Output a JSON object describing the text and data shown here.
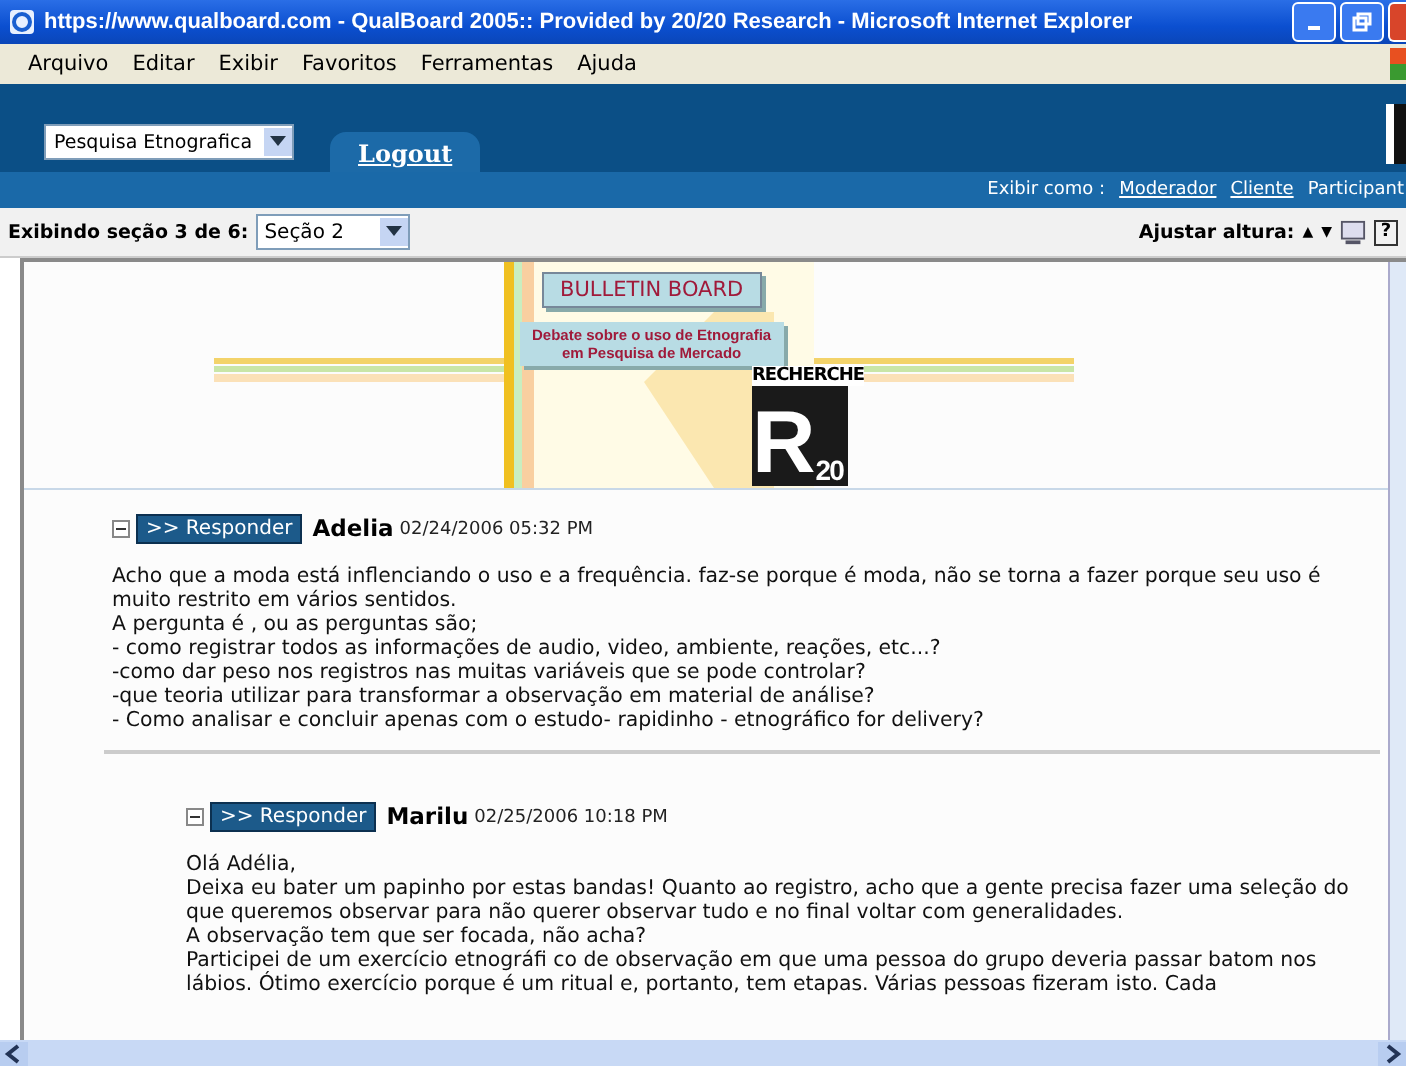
{
  "window": {
    "title": "https://www.qualboard.com - QualBoard 2005:: Provided by 20/20 Research - Microsoft Internet Explorer"
  },
  "menu": [
    "Arquivo",
    "Editar",
    "Exibir",
    "Favoritos",
    "Ferramentas",
    "Ajuda"
  ],
  "header": {
    "project_select": "Pesquisa Etnografica",
    "logout": "Logout",
    "view_as_label": "Exibir como :",
    "view_as": [
      {
        "label": "Moderador"
      },
      {
        "label": "Cliente"
      },
      {
        "label": "Participant"
      }
    ]
  },
  "toolbar": {
    "section_label": "Exibindo seção 3 de 6:",
    "section_select": "Seção 2",
    "height_label": "Ajustar altura:",
    "up": "▲",
    "down": "▼",
    "help": "?"
  },
  "banner": {
    "title": "BULLETIN BOARD",
    "subtitle": [
      "Debate sobre o uso de Etnografia",
      "em Pesquisa de Mercado"
    ],
    "logo": {
      "name": "RECHERCHE",
      "letter": "R",
      "years": "20"
    }
  },
  "posts": [
    {
      "expanded": true,
      "reply": ">> Responder",
      "author": "Adelia",
      "date": "02/24/2006 05:32 PM",
      "lines": [
        "Acho que a moda está inflenciando o uso e a frequência. faz-se porque é moda, não se torna a fazer porque seu uso é muito restrito em vários sentidos.",
        "A pergunta é , ou as perguntas são;",
        "- como registrar todos as informações de audio, video, ambiente, reações, etc...?",
        "-como dar peso nos registros nas muitas variáveis que se pode controlar?",
        "-que teoria utilizar para transformar a observação em material de análise?",
        "- Como analisar e concluir apenas com o estudo- rapidinho - etnográfico for delivery?"
      ],
      "children": [
        {
          "expanded": true,
          "reply": ">> Responder",
          "author": "Marilu",
          "date": "02/25/2006 10:18 PM",
          "lines": [
            "Olá Adélia,",
            "Deixa eu bater um papinho por estas bandas! Quanto ao registro, acho que a gente precisa fazer uma seleção do que queremos observar para não querer observar  tudo e no final voltar com  generalidades.",
            "A observação tem que ser focada, não acha?",
            "Participei de um exercício etnográfi co de observação em que uma pessoa do grupo deveria passar batom nos lábios. Ótimo exercício porque é um ritual e, portanto, tem etapas. Várias pessoas fizeram isto. Cada"
          ]
        }
      ]
    }
  ]
}
